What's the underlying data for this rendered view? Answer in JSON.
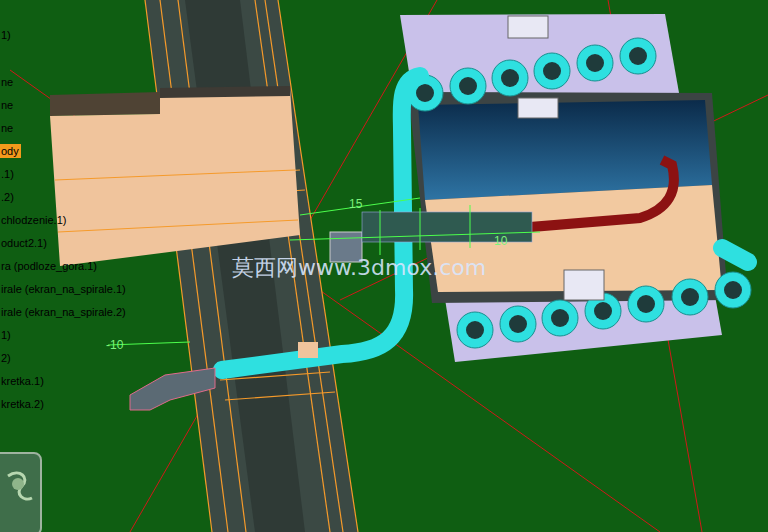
{
  "tree": {
    "items": [
      {
        "label": "1)",
        "selected": false
      },
      {
        "label": "ne",
        "selected": false
      },
      {
        "label": "ne",
        "selected": false
      },
      {
        "label": "ne",
        "selected": false
      },
      {
        "label": "ody",
        "selected": true
      },
      {
        "label": ".1)",
        "selected": false
      },
      {
        "label": ".2)",
        "selected": false
      },
      {
        "label": "chlodzenie.1)",
        "selected": false
      },
      {
        "label": "oduct2.1)",
        "selected": false
      },
      {
        "label": "ra (podloze_gora.1)",
        "selected": false
      },
      {
        "label": "irale (ekran_na_spirale.1)",
        "selected": false
      },
      {
        "label": "irale (ekran_na_spirale.2)",
        "selected": false
      },
      {
        "label": "1)",
        "selected": false
      },
      {
        "label": "2)",
        "selected": false
      },
      {
        "label": "kretka.1)",
        "selected": false
      },
      {
        "label": "kretka.2)",
        "selected": false
      }
    ]
  },
  "dimensions": [
    {
      "value": "15"
    },
    {
      "value": "10"
    },
    {
      "value": "-10"
    }
  ],
  "watermark": "莫西网www.3dmox.com"
}
